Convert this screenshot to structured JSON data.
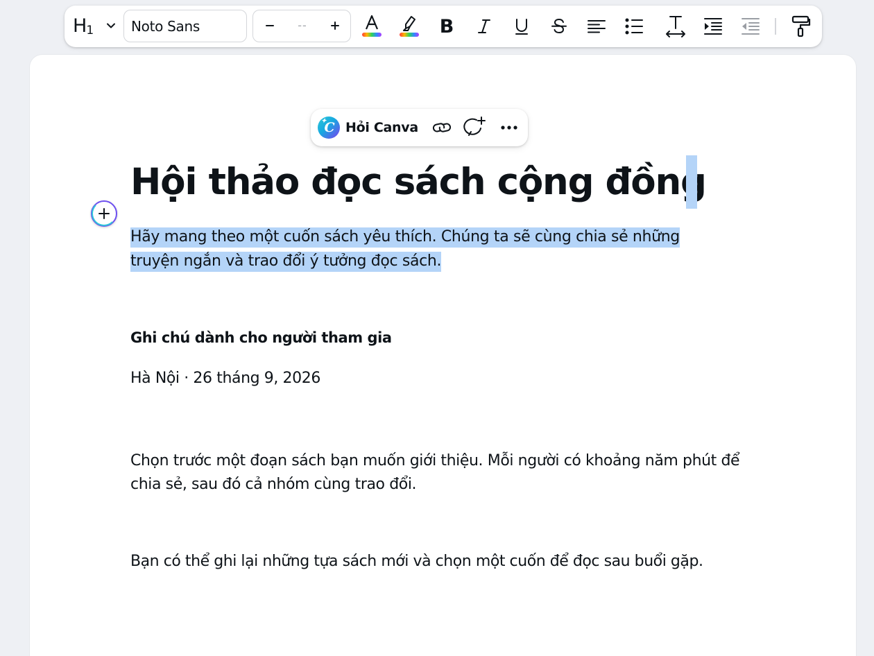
{
  "toolbar": {
    "heading_level": "H",
    "heading_sub": "1",
    "font_family": "Noto Sans",
    "font_size_value": "--",
    "icons": [
      "chevron-down-icon",
      "minus-icon",
      "plus-icon",
      "text-color-icon",
      "highlight-icon",
      "bold-icon",
      "italic-icon",
      "underline-icon",
      "strikethrough-icon",
      "align-left-icon",
      "bulleted-list-icon",
      "letter-spacing-icon",
      "indent-increase-icon",
      "indent-decrease-icon",
      "format-painter-icon"
    ],
    "bold_glyph": "B",
    "italic_glyph": "I",
    "underline_glyph": "U",
    "strike_glyph": "S",
    "color_glyph": "A"
  },
  "floatbar": {
    "ask_label": "Hỏi Canva",
    "logo_letter": "C",
    "icons": [
      "canva-logo-icon",
      "link-icon",
      "add-comment-icon",
      "more-icon"
    ]
  },
  "document": {
    "title": "Hội thảo đọc sách cộng đồng",
    "subtitle_line1": "Hãy mang theo một cuốn sách yêu thích. Chúng ta sẽ cùng chia sẻ những",
    "subtitle_line2": "truyện ngắn và trao đổi ý tưởng đọc sách.",
    "note_heading": "Ghi chú dành cho người tham gia",
    "place_date": "Hà Nội · 26 tháng 9, 2026",
    "paragraph1": "Chọn trước một đoạn sách bạn muốn giới thiệu. Mỗi người có khoảng năm phút để chia sẻ, sau đó cả nhóm cùng trao đổi.",
    "paragraph2": "Bạn có thể ghi lại những tựa sách mới và chọn một cuốn để đọc sau buổi gặp."
  },
  "colors": {
    "selection": "#b4d4f8",
    "text": "#0e1318",
    "accent_purple": "#6d4ff0",
    "accent_teal": "#2ec7d8"
  }
}
